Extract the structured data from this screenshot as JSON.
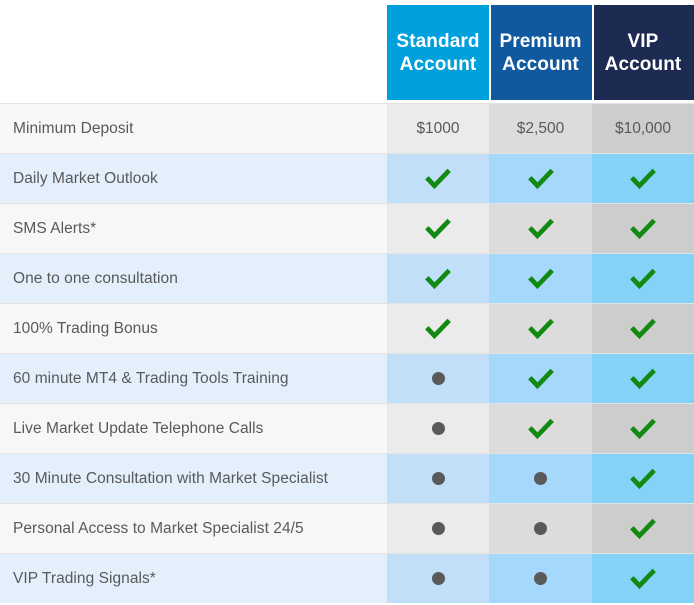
{
  "table": {
    "feature_column_header": "",
    "columns": [
      {
        "id": "standard",
        "name_line1": "Standard",
        "name_line2": "Account",
        "header_color": "#00a0dd"
      },
      {
        "id": "premium",
        "name_line1": "Premium",
        "name_line2": "Account",
        "header_color": "#10599f"
      },
      {
        "id": "vip",
        "name_line1": "VIP",
        "name_line2": "Account",
        "header_color": "#1d2a52"
      }
    ],
    "rows": [
      {
        "label": "Minimum Deposit",
        "type": "text",
        "values": [
          "$1000",
          "$2,500",
          "$10,000"
        ]
      },
      {
        "label": "Daily Market Outlook",
        "type": "mark",
        "values": [
          "check",
          "check",
          "check"
        ]
      },
      {
        "label": "SMS Alerts*",
        "type": "mark",
        "values": [
          "check",
          "check",
          "check"
        ]
      },
      {
        "label": "One to one consultation",
        "type": "mark",
        "values": [
          "check",
          "check",
          "check"
        ]
      },
      {
        "label": "100% Trading Bonus",
        "type": "mark",
        "values": [
          "check",
          "check",
          "check"
        ]
      },
      {
        "label": "60 minute MT4 & Trading Tools Training",
        "type": "mark",
        "values": [
          "dot",
          "check",
          "check"
        ]
      },
      {
        "label": "Live Market Update Telephone Calls",
        "type": "mark",
        "values": [
          "dot",
          "check",
          "check"
        ]
      },
      {
        "label": "30 Minute Consultation with Market Specialist",
        "type": "mark",
        "values": [
          "dot",
          "dot",
          "check"
        ]
      },
      {
        "label": "Personal Access to Market Specialist 24/5",
        "type": "mark",
        "values": [
          "dot",
          "dot",
          "check"
        ]
      },
      {
        "label": "VIP Trading Signals*",
        "type": "mark",
        "values": [
          "dot",
          "dot",
          "check"
        ]
      }
    ]
  },
  "icons": {
    "check": "check-icon",
    "dot": "dot-icon"
  },
  "colors": {
    "check_green": "#128a12",
    "dot_gray": "#595959",
    "label_text": "#58595b",
    "row_light_label": "#f7f7f7",
    "row_blue_label": "#e3f0fb",
    "standard_light": "#ebebeb",
    "premium_light": "#dcdcdc",
    "vip_light": "#cdcdcd",
    "standard_blue": "#c2dffa",
    "premium_blue": "#a6d8fb",
    "vip_blue": "#84d2f7"
  }
}
